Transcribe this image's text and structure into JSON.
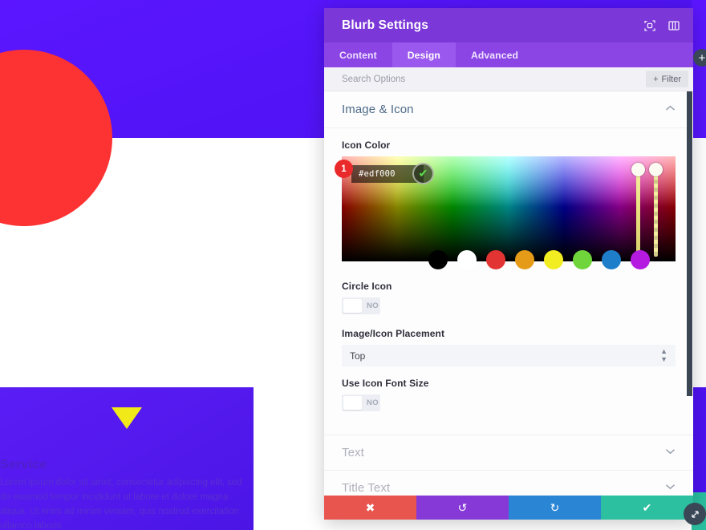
{
  "page": {
    "background": {
      "hero_color": "#4f14f2",
      "circle_color": "#fd3232"
    },
    "blurb": {
      "title": "Service",
      "body": "Lorem ipsum dolor sit amet, consectetur adipiscing elit, sed do eiusmod tempor incididunt ut labore et dolore magna aliqua. Ut enim ad minim veniam, quis nostrud exercitation ullamco laboris",
      "icon": "triangle-down-icon",
      "icon_color": "#f2ea18",
      "card_color": "#5b1df5"
    },
    "add_button_label": "+"
  },
  "modal": {
    "title": "Blurb Settings",
    "header_icons": [
      {
        "name": "focus-target-icon"
      },
      {
        "name": "layout-columns-icon"
      }
    ],
    "tabs": [
      {
        "label": "Content",
        "active": false
      },
      {
        "label": "Design",
        "active": true
      },
      {
        "label": "Advanced",
        "active": false
      }
    ],
    "search": {
      "placeholder": "Search Options",
      "value": ""
    },
    "filter_button": {
      "label": "Filter",
      "icon": "plus-icon"
    },
    "sections": {
      "image_icon": {
        "title": "Image & Icon",
        "expanded": true,
        "chevron": "chevron-up-icon"
      },
      "text": {
        "title": "Text",
        "expanded": false,
        "chevron": "chevron-down-icon"
      },
      "title_text": {
        "title": "Title Text",
        "expanded": false,
        "chevron": "chevron-down-icon"
      }
    },
    "fields": {
      "icon_color": {
        "label": "Icon Color",
        "hex_value": "#edf000",
        "badge": "1",
        "confirm_icon": "check-icon",
        "swatches": [
          {
            "name": "swatch-black",
            "color": "#000000"
          },
          {
            "name": "swatch-white",
            "color": "#ffffff"
          },
          {
            "name": "swatch-red",
            "color": "#e33434"
          },
          {
            "name": "swatch-orange",
            "color": "#e59b18"
          },
          {
            "name": "swatch-yellow",
            "color": "#f2ec22"
          },
          {
            "name": "swatch-green",
            "color": "#6fd53a"
          },
          {
            "name": "swatch-blue",
            "color": "#1f7ec9"
          },
          {
            "name": "swatch-purple",
            "color": "#b41ae0"
          }
        ]
      },
      "circle_icon": {
        "label": "Circle Icon",
        "value": "NO"
      },
      "image_icon_placement": {
        "label": "Image/Icon Placement",
        "value": "Top"
      },
      "use_icon_font_size": {
        "label": "Use Icon Font Size",
        "value": "NO"
      }
    },
    "footer": [
      {
        "name": "cancel-button",
        "icon": "✖",
        "color": "#e8554f"
      },
      {
        "name": "undo-button",
        "icon": "↺",
        "color": "#8639d6"
      },
      {
        "name": "redo-button",
        "icon": "↻",
        "color": "#2a86d4"
      },
      {
        "name": "save-button",
        "icon": "✔",
        "color": "#2cc0a0"
      }
    ],
    "resize_handle_icon": "resize-diagonal-icon"
  }
}
